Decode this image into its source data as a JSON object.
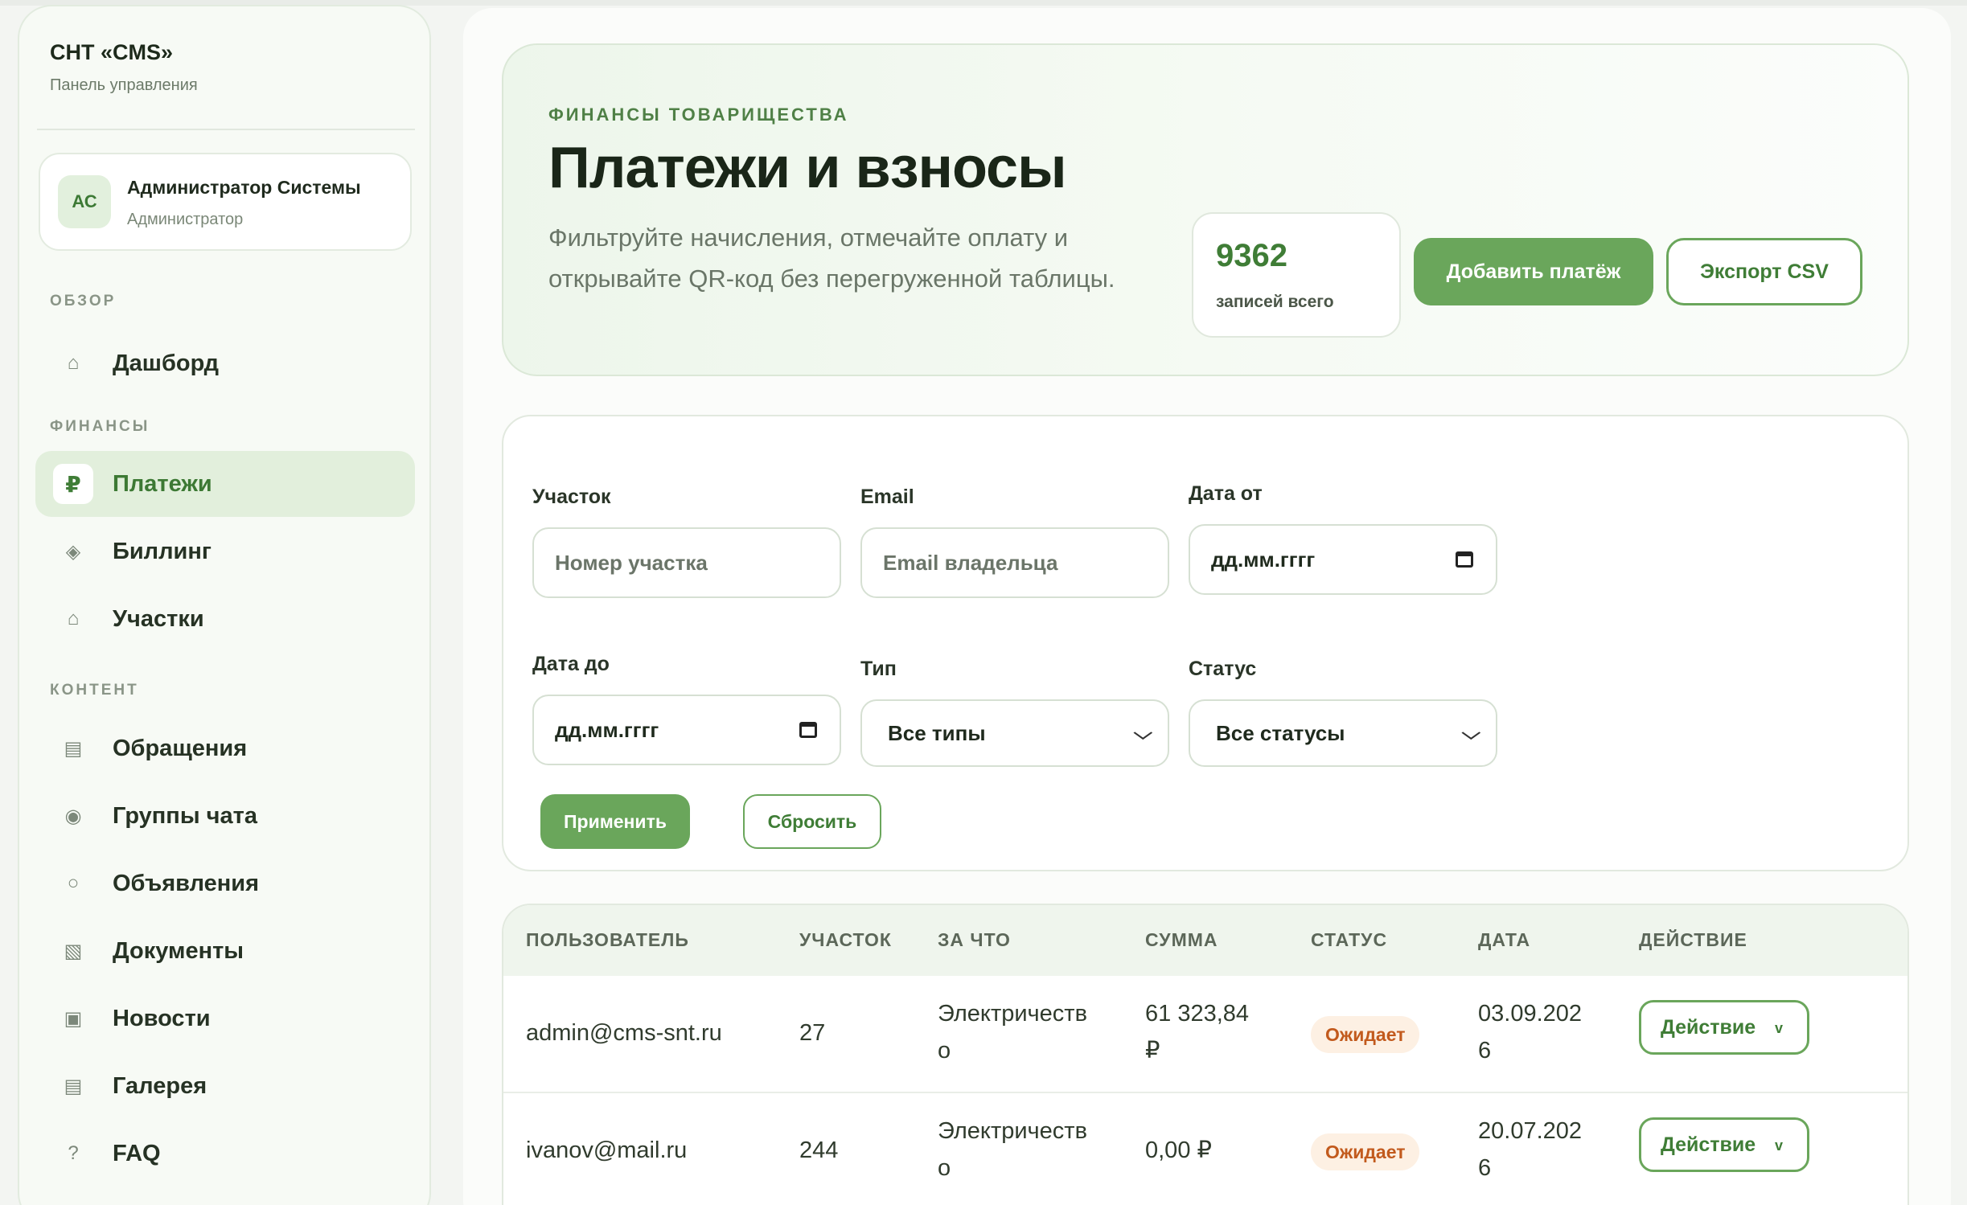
{
  "sidebar": {
    "brand_title": "СНТ «CMS»",
    "brand_subtitle": "Панель управления",
    "user": {
      "initials": "АС",
      "name": "Администратор Системы",
      "role": "Администратор"
    },
    "sections": {
      "overview": "ОБЗОР",
      "finance": "ФИНАНСЫ",
      "content": "КОНТЕНТ"
    },
    "items": [
      {
        "label": "Дашборд",
        "icon": "⌂"
      },
      {
        "label": "Платежи",
        "icon": "₽"
      },
      {
        "label": "Биллинг",
        "icon": "◈"
      },
      {
        "label": "Участки",
        "icon": "⌂"
      },
      {
        "label": "Обращения",
        "icon": "▤"
      },
      {
        "label": "Группы чата",
        "icon": "◉"
      },
      {
        "label": "Объявления",
        "icon": "○"
      },
      {
        "label": "Документы",
        "icon": "▧"
      },
      {
        "label": "Новости",
        "icon": "▣"
      },
      {
        "label": "Галерея",
        "icon": "▤"
      },
      {
        "label": "FAQ",
        "icon": "?"
      }
    ]
  },
  "hero": {
    "eyebrow": "ФИНАНСЫ ТОВАРИЩЕСТВА",
    "title": "Платежи и взносы",
    "description": "Фильтруйте начисления, отмечайте оплату и открывайте QR-код без перегруженной таблицы.",
    "count": "9362",
    "count_label": "записей всего",
    "add_button": "Добавить платёж",
    "export_button": "Экспорт CSV"
  },
  "filters": {
    "plot_label": "Участок",
    "plot_placeholder": "Номер участка",
    "email_label": "Email",
    "email_placeholder": "Email владельца",
    "date_from_label": "Дата от",
    "date_from_value": "дд.мм.гггг",
    "date_to_label": "Дата до",
    "date_to_value": "дд.мм.гггг",
    "type_label": "Тип",
    "type_value": "Все типы",
    "status_label": "Статус",
    "status_value": "Все статусы",
    "apply_button": "Применить",
    "reset_button": "Сбросить"
  },
  "table": {
    "headers": [
      "ПОЛЬЗОВАТЕЛЬ",
      "УЧАСТОК",
      "ЗА ЧТО",
      "СУММА",
      "СТАТУС",
      "ДАТА",
      "ДЕЙСТВИЕ"
    ],
    "rows": [
      {
        "user": "admin@cms-snt.ru",
        "plot": "27",
        "purpose_1": "Электричеств",
        "purpose_2": "о",
        "amount_1": "61 323,84",
        "amount_2": "₽",
        "status": "Ожидает",
        "date_1": "03.09.202",
        "date_2": "6",
        "action": "Действие"
      },
      {
        "user": "ivanov@mail.ru",
        "plot": "244",
        "purpose_1": "Электричеств",
        "purpose_2": "о",
        "amount_1": "0,00 ₽",
        "amount_2": "",
        "status": "Ожидает",
        "date_1": "20.07.202",
        "date_2": "6",
        "action": "Действие"
      }
    ],
    "action_chevron": "v"
  },
  "colors": {
    "accent": "#6aa65b",
    "accent_dark": "#3f7d36",
    "pending": "#c25a1d"
  }
}
